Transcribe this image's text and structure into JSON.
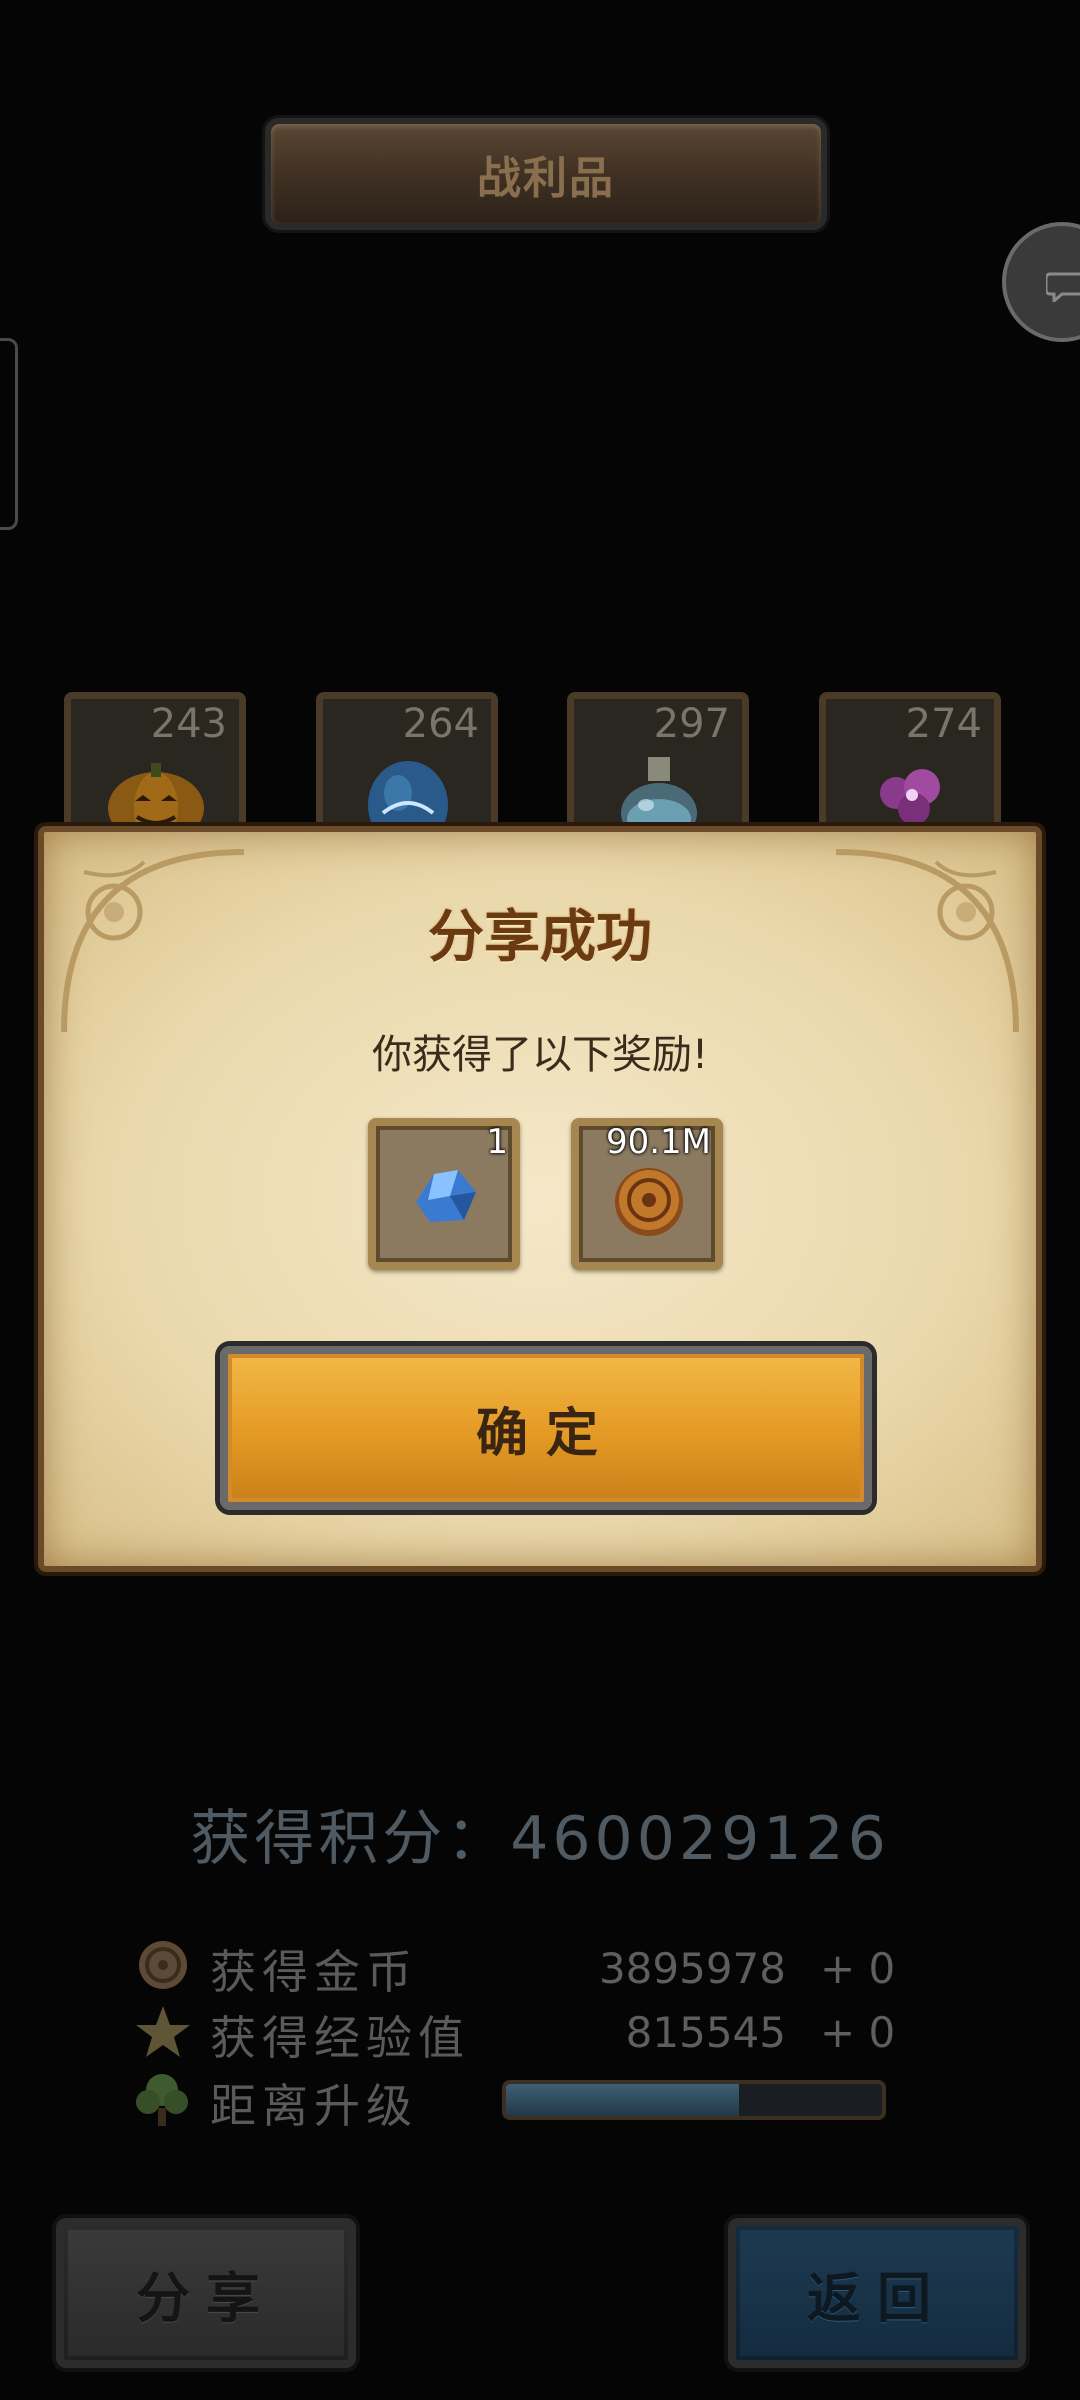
{
  "header": {
    "title": "战利品"
  },
  "loot": [
    {
      "count": "243",
      "icon": "pumpkin-icon"
    },
    {
      "count": "264",
      "icon": "egg-icon"
    },
    {
      "count": "297",
      "icon": "potion-icon"
    },
    {
      "count": "274",
      "icon": "flower-icon"
    }
  ],
  "dialog": {
    "title": "分享成功",
    "subtitle": "你获得了以下奖励!",
    "rewards": [
      {
        "count": "1",
        "icon": "crystal-icon"
      },
      {
        "count": "90.1M",
        "icon": "gold-coin-icon"
      }
    ],
    "confirm_label": "确定"
  },
  "score": {
    "text": "获得积分：460029126"
  },
  "stats": {
    "gold": {
      "label": "获得金币",
      "value": "3895978",
      "delta": "+ 0",
      "icon": "coin-icon"
    },
    "exp": {
      "label": "获得经验值",
      "value": "815545",
      "delta": "+ 0",
      "icon": "star-icon"
    },
    "level": {
      "label": "距离升级",
      "icon": "tree-icon",
      "progress": 0.62
    }
  },
  "buttons": {
    "share": "分享",
    "back": "返回"
  },
  "colors": {
    "dialog_bg": "#f4e8c8",
    "confirm": "#e49a24",
    "back": "#1d3a52"
  }
}
